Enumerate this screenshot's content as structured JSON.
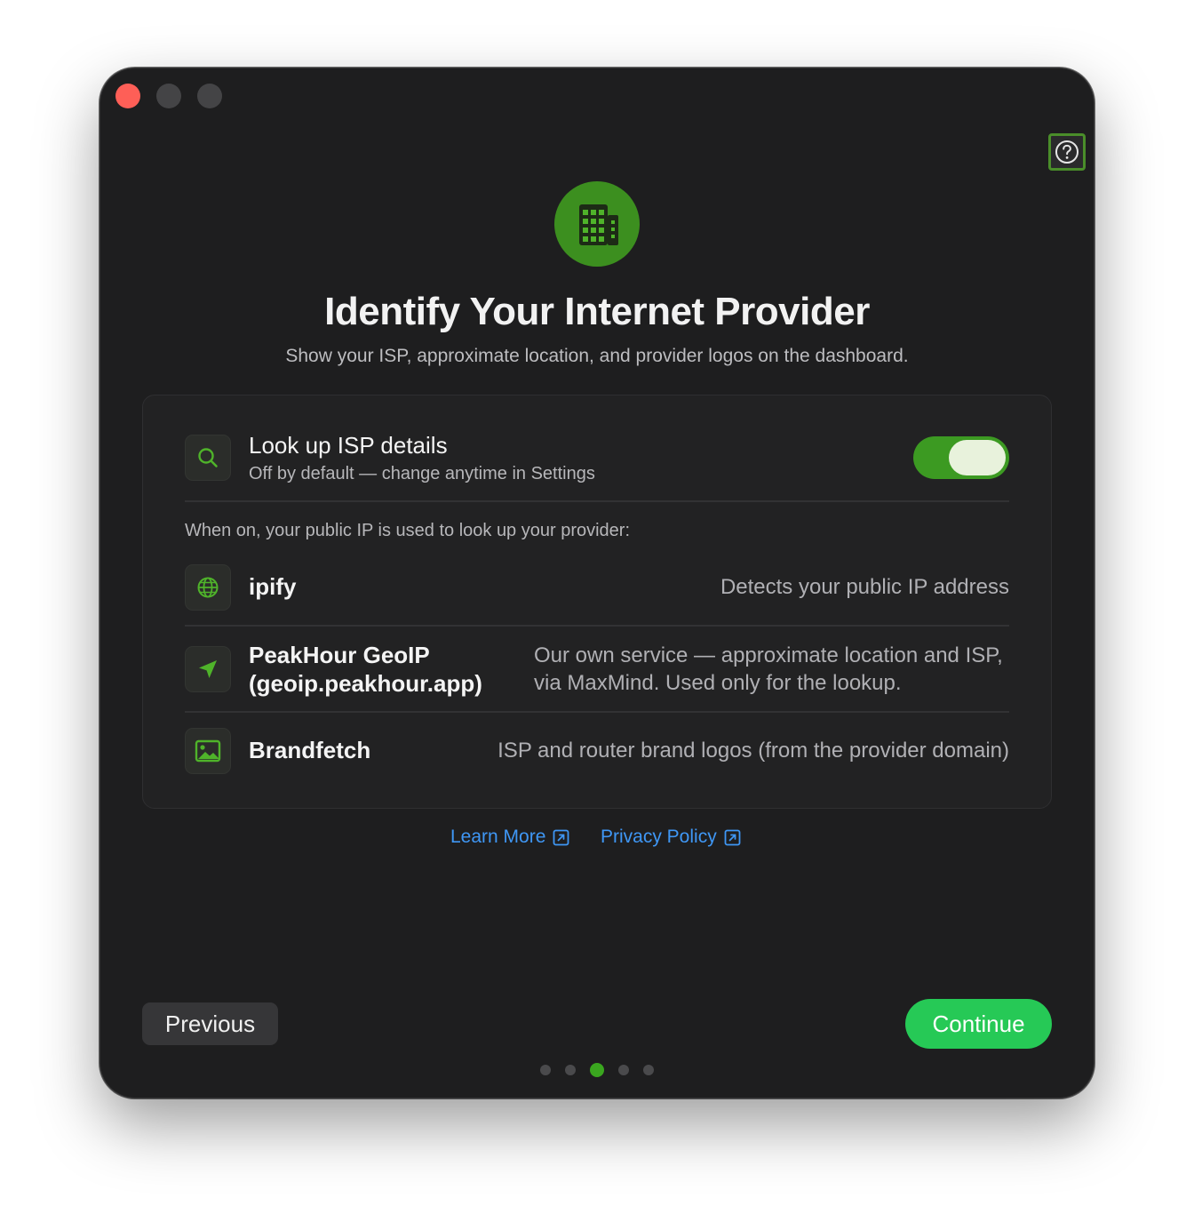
{
  "window": {
    "controls": [
      "close",
      "minimize",
      "zoom"
    ]
  },
  "help": {
    "icon": "question-circle-icon"
  },
  "hero": {
    "icon": "building-icon",
    "title": "Identify Your Internet Provider",
    "subtitle": "Show your ISP, approximate location, and provider logos on the dashboard."
  },
  "setting": {
    "icon": "search-icon",
    "title": "Look up ISP details",
    "subtitle": "Off by default — change anytime in Settings",
    "toggle_on": true
  },
  "services": {
    "intro": "When on, your public IP is used to look up your provider:",
    "items": [
      {
        "icon": "globe-icon",
        "name": "ipify",
        "description": "Detects your public IP address"
      },
      {
        "icon": "location-arrow-icon",
        "name": "PeakHour GeoIP (geoip.peakhour.app)",
        "description": "Our own service — approximate location and ISP, via MaxMind. Used only for the lookup."
      },
      {
        "icon": "photo-icon",
        "name": "Brandfetch",
        "description": "ISP and router brand logos (from the provider domain)"
      }
    ]
  },
  "links": {
    "learn_more": "Learn More",
    "privacy_policy": "Privacy Policy"
  },
  "nav": {
    "previous": "Previous",
    "continue": "Continue",
    "page_count": 5,
    "current_page": 3
  },
  "colors": {
    "accent_green": "#3c8f1f",
    "continue_green": "#26c956",
    "link_blue": "#3f97f5",
    "close_red": "#fe5f57"
  }
}
